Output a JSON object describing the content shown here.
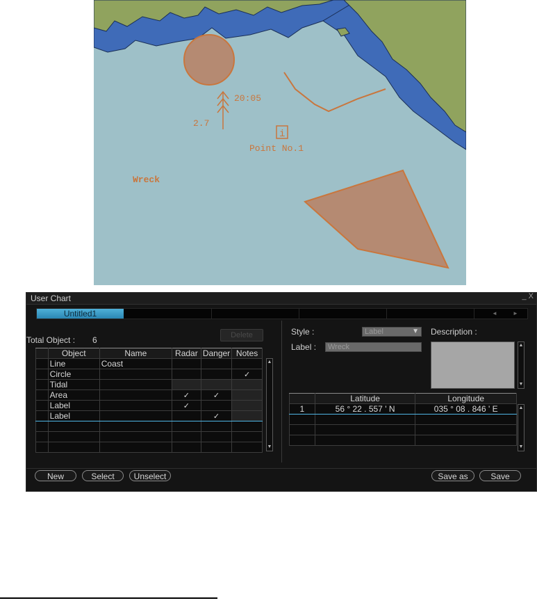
{
  "chart": {
    "time_label": "20:05",
    "speed_label": "2.7",
    "info_icon_text": "i",
    "point_label": "Point No.1",
    "wreck_label": "Wreck",
    "colors": {
      "sea": "#9ec0c8",
      "land": "#90a35e",
      "deep": "#3f6bb8",
      "coast": "#1a2e55",
      "user_obj": "#c9763d",
      "fill_obj": "#b58a72"
    }
  },
  "dialog": {
    "title": "User Chart",
    "window_controls": "_ X",
    "tabs": [
      {
        "label": "Untitled1",
        "active": true
      }
    ],
    "tab_arrow_left": "◄",
    "tab_arrow_right": "►",
    "total_object_label": "Total Object :",
    "total_object_value": "6",
    "delete_label": "Delete",
    "table": {
      "headers": [
        "Object",
        "Name",
        "Radar",
        "Danger",
        "Notes"
      ],
      "rows": [
        {
          "object": "Line",
          "name": "Coast",
          "radar": "",
          "danger": "",
          "notes": ""
        },
        {
          "object": "Circle",
          "name": "",
          "radar": "",
          "danger": "",
          "notes": "✓"
        },
        {
          "object": "Tidal",
          "name": "",
          "radar": "",
          "danger": "",
          "notes": ""
        },
        {
          "object": "Area",
          "name": "",
          "radar": "✓",
          "danger": "✓",
          "notes": ""
        },
        {
          "object": "Label",
          "name": "",
          "radar": "✓",
          "danger": "",
          "notes": ""
        },
        {
          "object": "Label",
          "name": "",
          "radar": "",
          "danger": "✓",
          "notes": ""
        }
      ]
    },
    "style_label": "Style :",
    "style_value": "Label",
    "label_label": "Label :",
    "label_value": "Wreck",
    "description_label": "Description :",
    "coords": {
      "headers": [
        "Latitude",
        "Longitude"
      ],
      "rows": [
        {
          "index": "1",
          "lat": "56 ° 22 . 557 ' N",
          "lon": "035 ° 08 . 846 ' E"
        }
      ]
    },
    "buttons": {
      "new": "New",
      "select": "Select",
      "unselect": "Unselect",
      "save_as": "Save as",
      "save": "Save"
    }
  }
}
